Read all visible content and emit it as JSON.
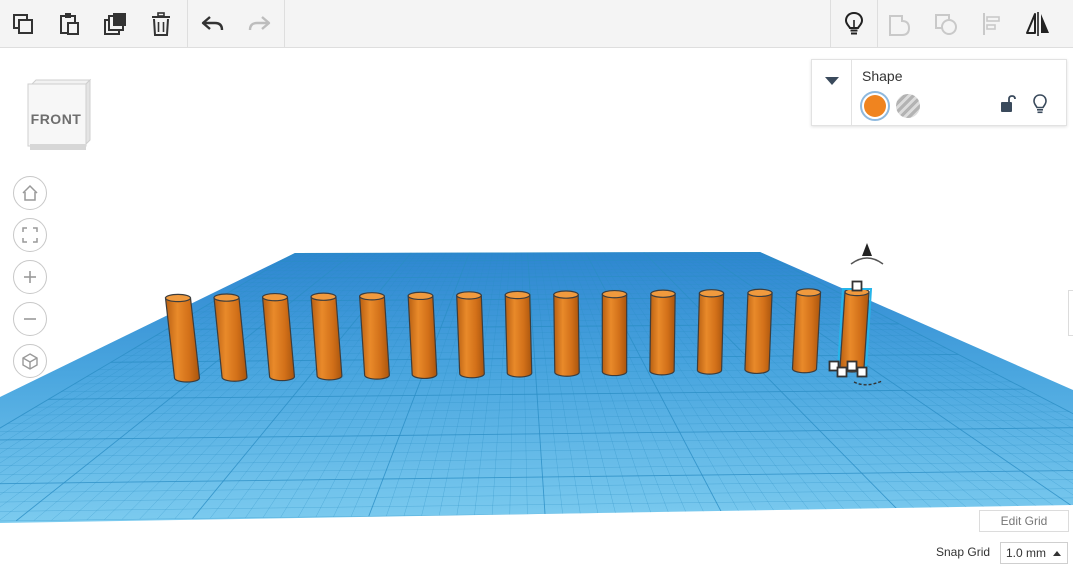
{
  "toolbar": {
    "left_tools": [
      {
        "name": "copy-icon"
      },
      {
        "name": "paste-icon"
      },
      {
        "name": "duplicate-icon"
      },
      {
        "name": "delete-icon"
      }
    ],
    "history_tools": [
      {
        "name": "undo-icon",
        "enabled": true
      },
      {
        "name": "redo-icon",
        "enabled": false
      }
    ],
    "right_tools": [
      {
        "name": "show-hints-icon",
        "enabled": true
      },
      {
        "name": "group-icon",
        "enabled": false
      },
      {
        "name": "ungroup-icon",
        "enabled": false
      },
      {
        "name": "align-icon",
        "enabled": false
      },
      {
        "name": "mirror-icon",
        "enabled": true
      }
    ]
  },
  "view_cube": {
    "face_label": "FRONT"
  },
  "nav_controls": [
    "home-view-icon",
    "fit-view-icon",
    "zoom-in-icon",
    "zoom-out-icon",
    "perspective-icon"
  ],
  "shape_panel": {
    "title": "Shape",
    "solid_color": "#f0841f",
    "hole_pattern": "striped-gray",
    "locked": false
  },
  "scene": {
    "workplane_color": "#54b3e3",
    "grid_line_color": "#2a8dc4",
    "shape_type": "cylinder",
    "shape_color": "#e17c1c",
    "cylinder_count": 15,
    "selected_index": 14,
    "selection_color": "#26b5ea"
  },
  "bottom": {
    "edit_grid_label": "Edit Grid",
    "snap_grid_label": "Snap Grid",
    "snap_grid_value": "1.0 mm"
  }
}
